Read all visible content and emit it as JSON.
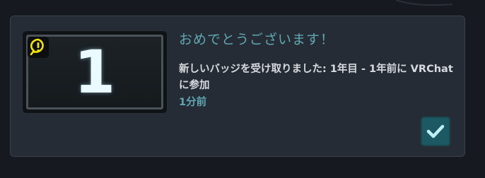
{
  "notification": {
    "title": "おめでとうございます！",
    "message": "新しいバッジを受け取りました: 1年目 - 1年前に VRChat に参加",
    "time": "1分前",
    "badge_number": "1"
  },
  "colors": {
    "accent": "#5fa8b4",
    "card_bg": "#262c35",
    "alert_yellow": "#f5e600",
    "check_bg": "#1d5963"
  },
  "icons": {
    "alert": "exclamation-bubble-icon",
    "confirm": "check-icon"
  }
}
